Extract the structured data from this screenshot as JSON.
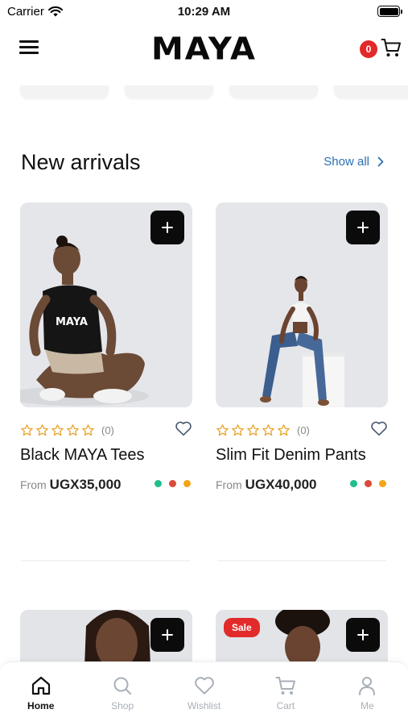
{
  "status_bar": {
    "carrier": "Carrier",
    "time": "10:29 AM"
  },
  "header": {
    "brand": "MAYA",
    "cart_count": "0"
  },
  "section": {
    "title": "New arrivals",
    "show_all": "Show all"
  },
  "products": [
    {
      "name": "Black MAYA Tees",
      "rating_count": "(0)",
      "from_label": "From",
      "price": "UGX35,000",
      "rating": 0
    },
    {
      "name": "Slim Fit Denim Pants",
      "rating_count": "(0)",
      "from_label": "From",
      "price": "UGX40,000",
      "rating": 0
    }
  ],
  "color_options": [
    "#1fbf8c",
    "#d94a3a",
    "#f2a516"
  ],
  "next_row": {
    "sale_label": "Sale"
  },
  "tabs": [
    {
      "label": "Home",
      "icon": "home-icon",
      "active": true
    },
    {
      "label": "Shop",
      "icon": "search-icon",
      "active": false
    },
    {
      "label": "Wishlist",
      "icon": "heart-icon",
      "active": false
    },
    {
      "label": "Cart",
      "icon": "cart-icon",
      "active": false
    },
    {
      "label": "Me",
      "icon": "user-icon",
      "active": false
    }
  ],
  "colors": {
    "accent_link": "#2a6fb0",
    "badge_red": "#e32a2a",
    "star_gold": "#e8a32a"
  }
}
